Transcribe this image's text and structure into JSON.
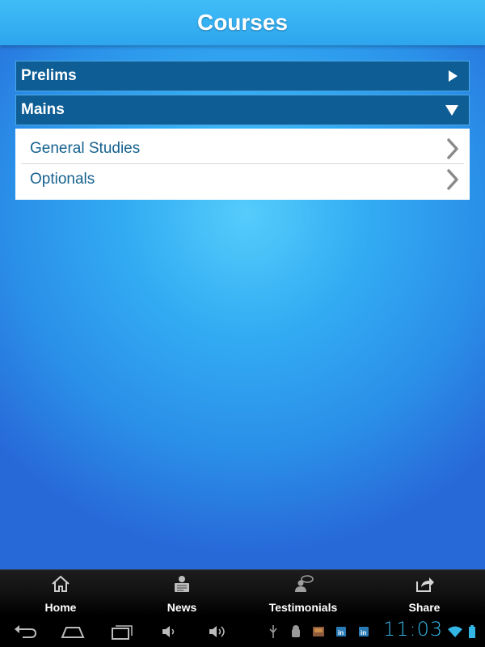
{
  "header": {
    "title": "Courses"
  },
  "sections": [
    {
      "label": "Prelims",
      "state": "collapsed"
    },
    {
      "label": "Mains",
      "state": "expanded",
      "items": [
        {
          "label": "General Studies"
        },
        {
          "label": "Optionals"
        }
      ]
    }
  ],
  "tabbar": {
    "tabs": [
      {
        "label": "Home",
        "icon": "home-icon"
      },
      {
        "label": "News",
        "icon": "news-icon"
      },
      {
        "label": "Testimonials",
        "icon": "testimonials-icon"
      },
      {
        "label": "Share",
        "icon": "share-icon"
      }
    ]
  },
  "system_bar": {
    "time": "11:03",
    "buttons": [
      "back-icon",
      "home-icon",
      "recent-apps-icon",
      "volume-down-icon",
      "volume-up-icon"
    ],
    "status_icons": [
      "usb-icon",
      "android-debug-icon",
      "gallery-icon",
      "linkedin-icon",
      "linkedin-icon",
      "wifi-icon",
      "battery-icon"
    ]
  },
  "colors": {
    "header_bg": "#3fbdf7",
    "section_bg": "#0e5e95",
    "submenu_text": "#16628f",
    "clock": "#33b5e5"
  }
}
